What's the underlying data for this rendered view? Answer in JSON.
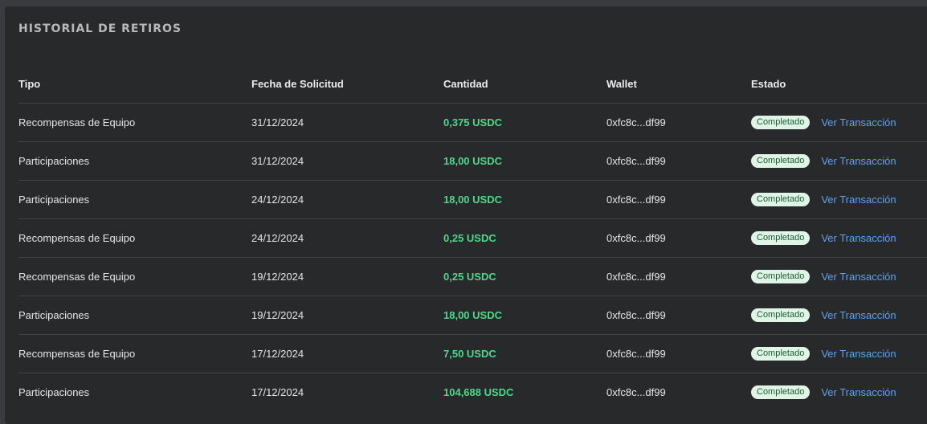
{
  "title": "HISTORIAL DE RETIROS",
  "headers": {
    "tipo": "Tipo",
    "fecha": "Fecha de Solicitud",
    "cantidad": "Cantidad",
    "wallet": "Wallet",
    "estado": "Estado"
  },
  "rows": [
    {
      "tipo": "Recompensas de Equipo",
      "fecha": "31/12/2024",
      "cantidad": "0,375 USDC",
      "wallet": "0xfc8c...df99",
      "estado": "Completado",
      "link": "Ver Transacción"
    },
    {
      "tipo": "Participaciones",
      "fecha": "31/12/2024",
      "cantidad": "18,00 USDC",
      "wallet": "0xfc8c...df99",
      "estado": "Completado",
      "link": "Ver Transacción"
    },
    {
      "tipo": "Participaciones",
      "fecha": "24/12/2024",
      "cantidad": "18,00 USDC",
      "wallet": "0xfc8c...df99",
      "estado": "Completado",
      "link": "Ver Transacción"
    },
    {
      "tipo": "Recompensas de Equipo",
      "fecha": "24/12/2024",
      "cantidad": "0,25 USDC",
      "wallet": "0xfc8c...df99",
      "estado": "Completado",
      "link": "Ver Transacción"
    },
    {
      "tipo": "Recompensas de Equipo",
      "fecha": "19/12/2024",
      "cantidad": "0,25 USDC",
      "wallet": "0xfc8c...df99",
      "estado": "Completado",
      "link": "Ver Transacción"
    },
    {
      "tipo": "Participaciones",
      "fecha": "19/12/2024",
      "cantidad": "18,00 USDC",
      "wallet": "0xfc8c...df99",
      "estado": "Completado",
      "link": "Ver Transacción"
    },
    {
      "tipo": "Recompensas de Equipo",
      "fecha": "17/12/2024",
      "cantidad": "7,50 USDC",
      "wallet": "0xfc8c...df99",
      "estado": "Completado",
      "link": "Ver Transacción"
    },
    {
      "tipo": "Participaciones",
      "fecha": "17/12/2024",
      "cantidad": "104,688 USDC",
      "wallet": "0xfc8c...df99",
      "estado": "Completado",
      "link": "Ver Transacción"
    }
  ],
  "colors": {
    "amount": "#4ed88a",
    "badge_bg": "#dff6e7",
    "link": "#5fa3f0"
  }
}
